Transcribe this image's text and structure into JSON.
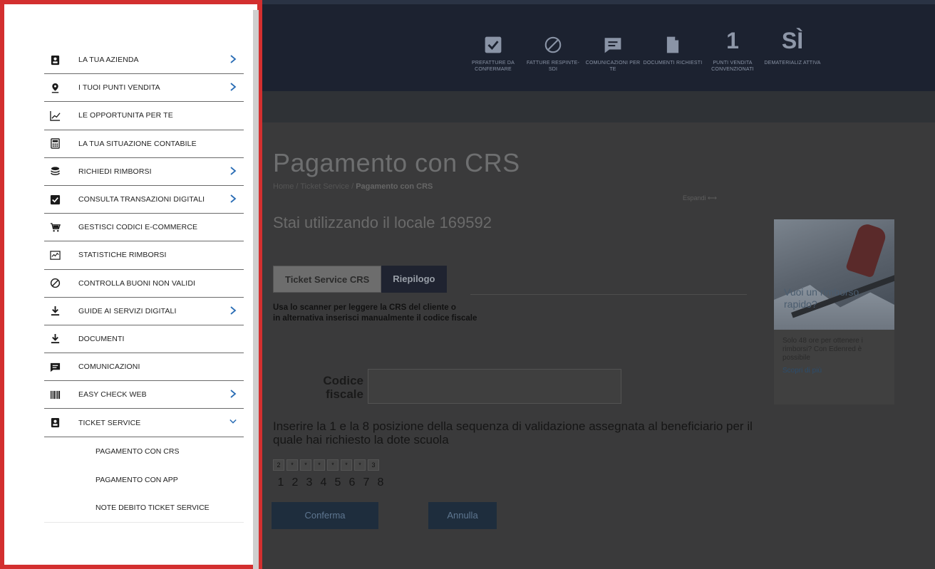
{
  "header": {
    "stats": [
      {
        "icon": "checkbox-icon",
        "big": "",
        "label": "PREFATTURE DA CONFERMARE"
      },
      {
        "icon": "forbidden-icon",
        "big": "",
        "label": "FATTURE RESPINTE-SDI"
      },
      {
        "icon": "chat-icon",
        "big": "",
        "label": "COMUNICAZIONI PER TE"
      },
      {
        "icon": "document-icon",
        "big": "",
        "label": "DOCUMENTI RICHIESTI"
      },
      {
        "icon": "",
        "big": "1",
        "label": "PUNTI VENDITA CONVENZIONATI"
      },
      {
        "icon": "",
        "big": "SÌ",
        "label": "DEMATERIALIZ ATTIVA"
      }
    ]
  },
  "sidebar": {
    "items": [
      {
        "label": "LA TUA AZIENDA",
        "icon": "badge-icon",
        "arrow": true
      },
      {
        "label": "I TUOI PUNTI VENDITA",
        "icon": "location-pin-icon",
        "arrow": true
      },
      {
        "label": "LE OPPORTUNITA PER TE",
        "icon": "trend-chart-icon",
        "arrow": false
      },
      {
        "label": "LA TUA SITUAZIONE CONTABILE",
        "icon": "calculator-icon",
        "arrow": false
      },
      {
        "label": "RICHIEDI RIMBORSI",
        "icon": "coins-icon",
        "arrow": true
      },
      {
        "label": "CONSULTA TRANSAZIONI DIGITALI",
        "icon": "checkbox-icon",
        "arrow": true
      },
      {
        "label": "GESTISCI CODICI E-COMMERCE",
        "icon": "cart-icon",
        "arrow": false
      },
      {
        "label": "STATISTICHE RIMBORSI",
        "icon": "stats-icon",
        "arrow": false
      },
      {
        "label": "CONTROLLA BUONI NON VALIDI",
        "icon": "forbidden-icon",
        "arrow": false
      },
      {
        "label": "GUIDE AI SERVIZI DIGITALI",
        "icon": "download-icon",
        "arrow": true
      },
      {
        "label": "DOCUMENTI",
        "icon": "download-icon",
        "arrow": false
      },
      {
        "label": "COMUNICAZIONI",
        "icon": "chat-icon",
        "arrow": false
      },
      {
        "label": "EASY CHECK WEB",
        "icon": "barcode-icon",
        "arrow": true
      },
      {
        "label": "TICKET SERVICE",
        "icon": "badge-icon",
        "arrow": "down"
      }
    ],
    "subitems": [
      "PAGAMENTO CON CRS",
      "PAGAMENTO CON APP",
      "NOTE DEBITO TICKET SERVICE"
    ]
  },
  "main": {
    "title": "Pagamento con CRS",
    "breadcrumb": {
      "home": "Home",
      "sep": "/",
      "section": "Ticket Service",
      "current": "Pagamento con CRS"
    },
    "expand": "Espandi",
    "locale": "Stai utilizzando il locale 169592",
    "tabs": [
      "Ticket Service CRS",
      "Riepilogo"
    ],
    "hint_line1": "Usa lo scanner per leggere la CRS del cliente o",
    "hint_line2": "in alternativa inserisci manualmente il codice fiscale",
    "cf_label": "Codice fiscale",
    "cf_value": "",
    "instructions": "Inserire la 1 e la 8 posizione della sequenza di validazione assegnata al beneficiario per il quale hai richiesto la dote scuola",
    "sequence": [
      "2",
      "*",
      "*",
      "*",
      "*",
      "*",
      "*",
      "3"
    ],
    "positions": [
      "1",
      "2",
      "3",
      "4",
      "5",
      "6",
      "7",
      "8"
    ],
    "confirm": "Conferma",
    "cancel": "Annulla"
  },
  "promo": {
    "overlay": "Vuoi un rimborso rapido?",
    "text": "Solo 48 ore per ottenere i rimborsi? Con Edenred è possibile",
    "link": "Scopri di più"
  }
}
